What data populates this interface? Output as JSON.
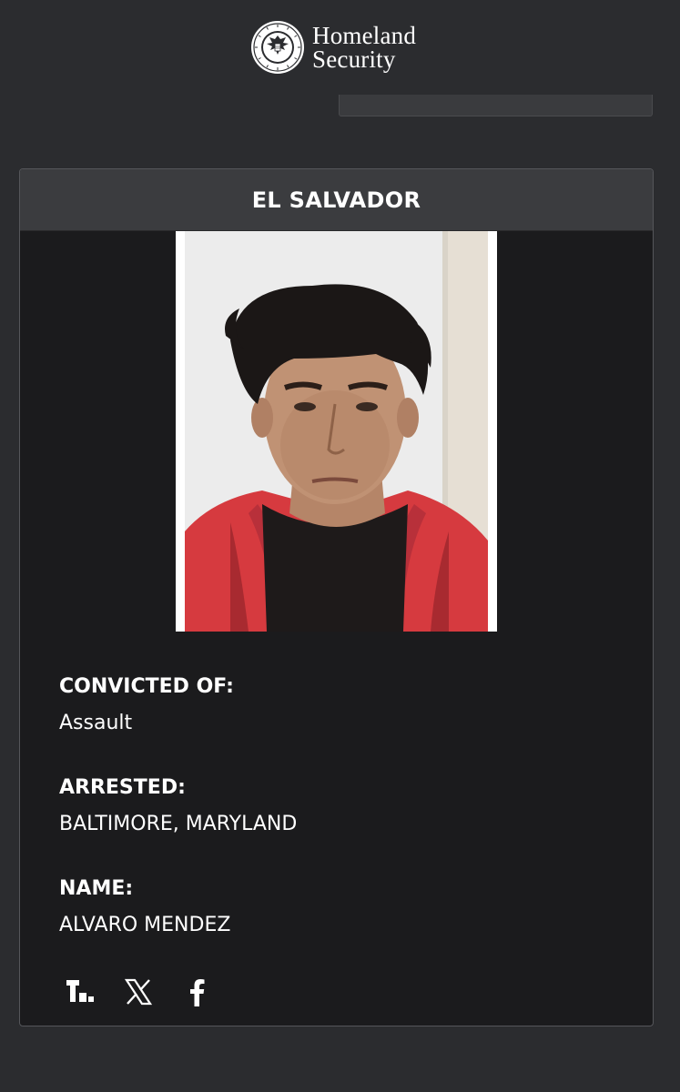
{
  "header": {
    "logo_line1": "Homeland",
    "logo_line2": "Security",
    "seal_text": "U.S. DEPARTMENT OF HOMELAND SECURITY"
  },
  "card": {
    "country": "EL SALVADOR",
    "photo_icon": "mugshot-photo",
    "fields": [
      {
        "label": "CONVICTED OF:",
        "value": "Assault"
      },
      {
        "label": "ARRESTED:",
        "value": "BALTIMORE, MARYLAND"
      },
      {
        "label": "NAME:",
        "value": "ALVARO MENDEZ"
      }
    ]
  },
  "share": {
    "icons": [
      "truth-social-icon",
      "x-icon",
      "facebook-icon"
    ]
  },
  "colors": {
    "background": "#2b2c2f",
    "card": "#1b1b1d",
    "card_header": "#3b3c3f",
    "text": "#ffffff"
  }
}
